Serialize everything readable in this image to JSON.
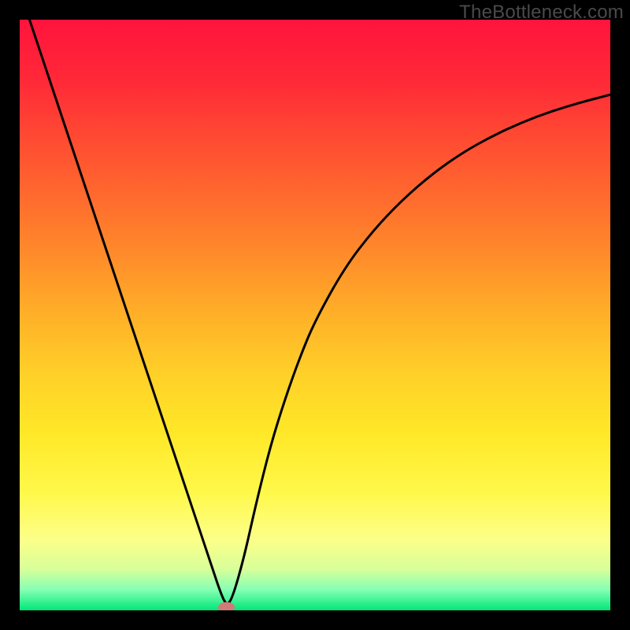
{
  "watermark": "TheBottleneck.com",
  "chart_data": {
    "type": "line",
    "title": "",
    "xlabel": "",
    "ylabel": "",
    "xlim": [
      0,
      100
    ],
    "ylim": [
      0,
      100
    ],
    "grid": false,
    "legend": false,
    "background": {
      "type": "vertical-gradient",
      "stops": [
        {
          "pos": 0.0,
          "color": "#ff143c"
        },
        {
          "pos": 0.1,
          "color": "#ff2838"
        },
        {
          "pos": 0.2,
          "color": "#ff4a32"
        },
        {
          "pos": 0.3,
          "color": "#ff6a2e"
        },
        {
          "pos": 0.4,
          "color": "#ff8c2a"
        },
        {
          "pos": 0.5,
          "color": "#ffb028"
        },
        {
          "pos": 0.6,
          "color": "#ffd028"
        },
        {
          "pos": 0.7,
          "color": "#ffe828"
        },
        {
          "pos": 0.8,
          "color": "#fff84a"
        },
        {
          "pos": 0.88,
          "color": "#fcff88"
        },
        {
          "pos": 0.93,
          "color": "#d8ff9a"
        },
        {
          "pos": 0.965,
          "color": "#86ffb4"
        },
        {
          "pos": 1.0,
          "color": "#00e878"
        }
      ]
    },
    "series": [
      {
        "name": "bottleneck-curve",
        "color": "#000000",
        "stroke_width": 3,
        "x": [
          0.0,
          2.5,
          5.0,
          7.5,
          10.0,
          12.5,
          15.0,
          17.5,
          20.0,
          22.5,
          25.0,
          27.5,
          30.0,
          32.5,
          34.0,
          35.0,
          36.0,
          38.0,
          40.0,
          42.5,
          45.0,
          47.5,
          50.0,
          55.0,
          60.0,
          65.0,
          70.0,
          75.0,
          80.0,
          85.0,
          90.0,
          95.0,
          100.0
        ],
        "y": [
          105.0,
          97.5,
          90.0,
          82.5,
          75.0,
          67.5,
          60.0,
          52.5,
          45.0,
          37.5,
          30.0,
          22.5,
          15.0,
          7.5,
          3.0,
          0.8,
          2.0,
          9.0,
          18.0,
          28.0,
          36.0,
          43.0,
          49.0,
          58.0,
          64.5,
          69.7,
          74.0,
          77.5,
          80.3,
          82.6,
          84.5,
          86.0,
          87.3
        ]
      }
    ],
    "marker": {
      "name": "optimal-point",
      "x": 35.0,
      "y": 0.5,
      "shape": "ellipse",
      "rx": 1.4,
      "ry": 0.9,
      "fill": "#cf7b78"
    }
  }
}
